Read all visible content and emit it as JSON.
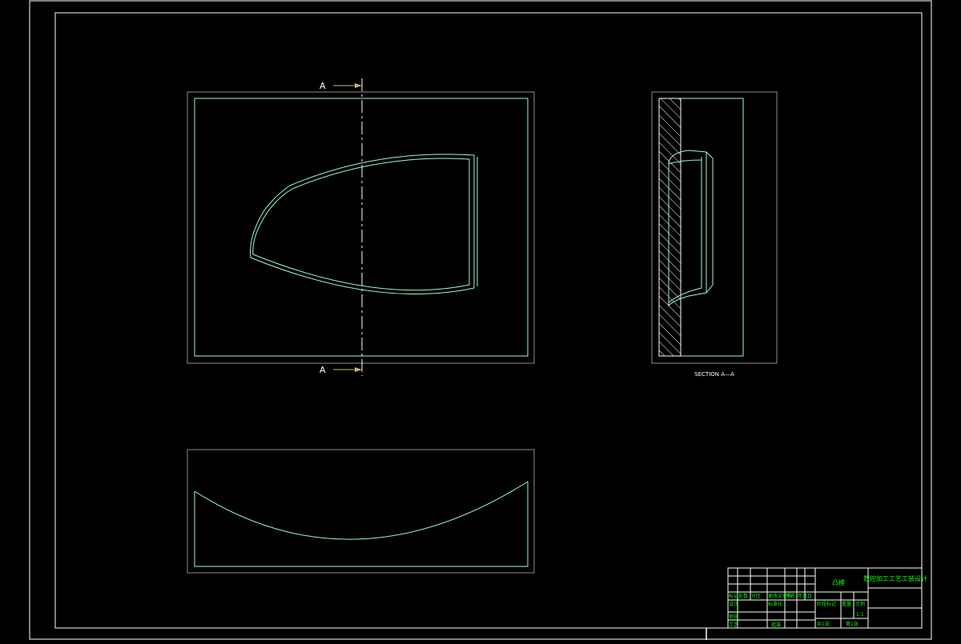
{
  "drawing": {
    "section_marker_top": "A",
    "section_marker_bottom": "A",
    "section_caption": "SECTION A—A"
  },
  "title_block": {
    "part_name": "凸模",
    "drawing_title": "数控加工工艺工装设计",
    "row_labels": [
      "标记",
      "处数",
      "分区",
      "更改文件号",
      "签名",
      "年月日"
    ],
    "lower_labels": [
      "设计",
      "标准化",
      "审核",
      "工艺",
      "批准"
    ],
    "stage_labels": [
      "阶段标记",
      "重量",
      "比例"
    ],
    "scale": "1:1",
    "sheet_total": "共1张",
    "sheet_no": "第1张"
  },
  "colors": {
    "background": "#000000",
    "frame": "#ffffff",
    "part_outline": "#9efad0",
    "section_arrow": "#c8b27a",
    "title_text": "#00ff00",
    "grey_line": "#8c8c8c"
  }
}
